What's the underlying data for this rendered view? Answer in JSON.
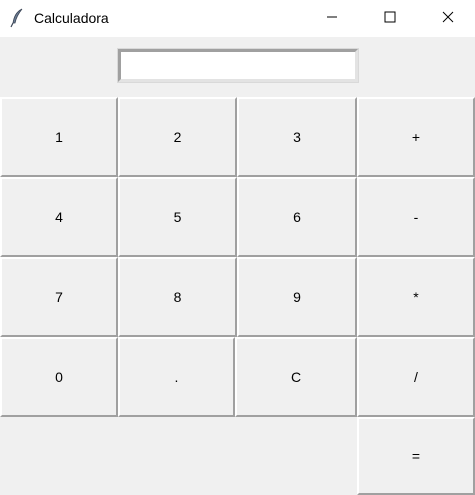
{
  "window": {
    "title": "Calculadora",
    "icon": "feather-icon",
    "controls": [
      "minimize-icon",
      "maximize-icon",
      "close-icon"
    ]
  },
  "display": {
    "value": ""
  },
  "keys": {
    "k1": "1",
    "k2": "2",
    "k3": "3",
    "plus": "+",
    "k4": "4",
    "k5": "5",
    "k6": "6",
    "minus": "-",
    "k7": "7",
    "k8": "8",
    "k9": "9",
    "multiply": "*",
    "k0": "0",
    "dot": ".",
    "clear": "C",
    "divide": "/",
    "equals": "="
  }
}
